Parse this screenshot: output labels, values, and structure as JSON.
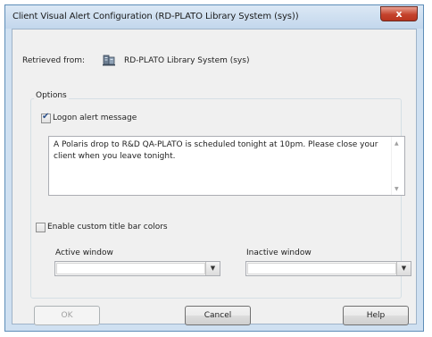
{
  "window": {
    "title": "Client Visual Alert Configuration (RD-PLATO Library System (sys))",
    "close_label": "x"
  },
  "retrieved": {
    "label": "Retrieved from:",
    "icon": "server-icon",
    "value": "RD-PLATO Library System (sys)"
  },
  "options": {
    "group_label": "Options",
    "logon_alert": {
      "label": "Logon alert message",
      "checked": true,
      "message": "A Polaris drop to R&D QA-PLATO is scheduled tonight at 10pm. Please close your client when you leave tonight."
    },
    "custom_colors": {
      "label": "Enable custom title bar colors",
      "checked": false
    },
    "active_window": {
      "label": "Active window",
      "value": ""
    },
    "inactive_window": {
      "label": "Inactive window",
      "value": ""
    }
  },
  "buttons": {
    "ok": "OK",
    "cancel": "Cancel",
    "help": "Help"
  },
  "colors": {
    "title_bar": "#c3d7ec",
    "close_button": "#c5432d",
    "dialog_background": "#f0f0f0"
  }
}
